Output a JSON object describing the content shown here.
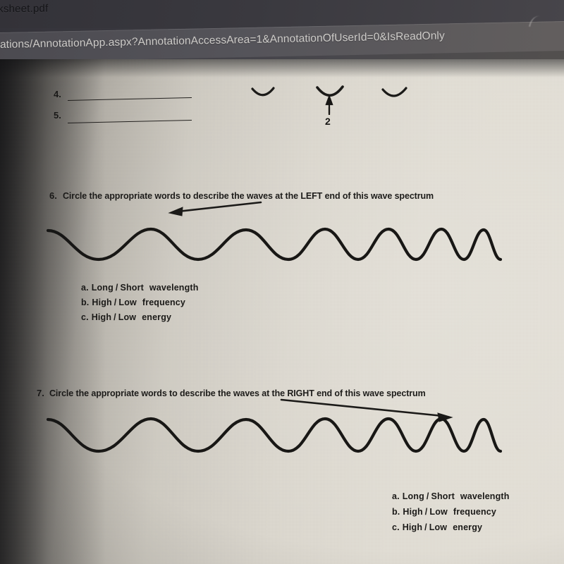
{
  "browser": {
    "tab_title": "rksheet.pdf",
    "url": "ations/AnnotationApp.aspx?AnnotationAccessArea=1&AnnotationOfUserId=0&IsReadOnly",
    "cursor_icon": "text-cursor-icon"
  },
  "worksheet": {
    "blank_questions": [
      {
        "number": "4."
      },
      {
        "number": "5."
      }
    ],
    "trough_diagram": {
      "label": "2",
      "shape_count": 3,
      "arrow_icon": "up-arrow-icon"
    },
    "questions": [
      {
        "number": "6.",
        "text": "Circle the appropriate words to describe the waves at the LEFT end of this wave spectrum",
        "arrow_icon": "left-arrow-icon",
        "options": [
          {
            "label": "a.",
            "word1": "Long",
            "sep": "/",
            "word2": "Short",
            "term": "wavelength"
          },
          {
            "label": "b.",
            "word1": "High",
            "sep": "/",
            "word2": "Low",
            "term": "frequency"
          },
          {
            "label": "c.",
            "word1": "High",
            "sep": "/",
            "word2": "Low",
            "term": "energy"
          }
        ]
      },
      {
        "number": "7.",
        "text": "Circle the appropriate words to describe the waves at the RIGHT end of this wave spectrum",
        "arrow_icon": "right-arrow-icon",
        "options": [
          {
            "label": "a.",
            "word1": "Long",
            "sep": "/",
            "word2": "Short",
            "term": "wavelength"
          },
          {
            "label": "b.",
            "word1": "High",
            "sep": "/",
            "word2": "Low",
            "term": "frequency"
          },
          {
            "label": "c.",
            "word1": "High",
            "sep": "/",
            "word2": "Low",
            "term": "energy"
          }
        ]
      }
    ]
  },
  "colors": {
    "ink": "#1d1c1a",
    "paper": "#e0dcd3",
    "chrome": "#44434a",
    "shadow": "#2e2d31"
  }
}
